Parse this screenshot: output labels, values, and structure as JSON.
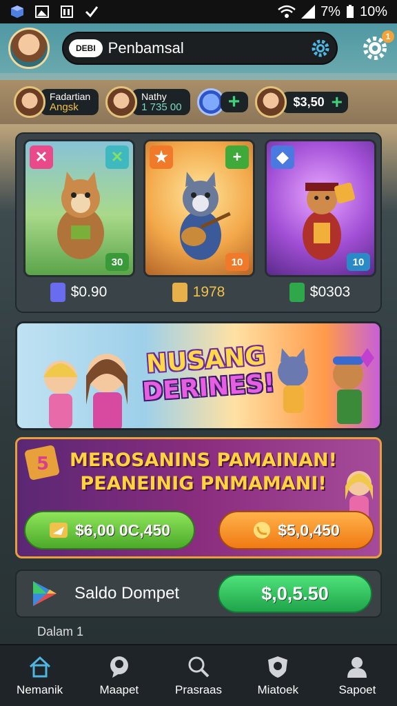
{
  "status_bar": {
    "signal_text": "7%",
    "battery_text": "10%"
  },
  "header": {
    "logo_text": "DEBI",
    "title": "Penbamsal",
    "notification_count": "1"
  },
  "friends": [
    {
      "name": "Fadartian",
      "value": "Angsk"
    },
    {
      "name": "Nathy",
      "value": "1 735 00"
    },
    {
      "name": "",
      "value": ""
    },
    {
      "name": "",
      "value": "$3,50"
    }
  ],
  "cards": [
    {
      "level": "30",
      "price": "$0.90",
      "tag_left": "✕",
      "tag_right": "✕",
      "price_color": "#6a6cf0"
    },
    {
      "level": "10",
      "price": "1978",
      "tag_left": "★",
      "tag_right": "+",
      "price_color": "#e8b04a"
    },
    {
      "level": "10",
      "price": "$0303",
      "tag_left": "◆",
      "tag_right": "",
      "price_color": "#2ea84a"
    }
  ],
  "banner": {
    "line1": "NUSANG",
    "line2": "DERINES!"
  },
  "promo": {
    "line1": "MEROSANINS PAMAINAN!",
    "line2": "PEANEINIG PNMAMANI!",
    "btn_green": "$6,00 0C,450",
    "btn_orange": "$5,0,450"
  },
  "wallet": {
    "label": "Saldo Dompet",
    "amount": "$,0,5.50"
  },
  "peek_text": "Dalam 1",
  "nav": [
    {
      "label": "Nemanik",
      "icon": "home-icon"
    },
    {
      "label": "Maapet",
      "icon": "chat-icon"
    },
    {
      "label": "Prasraas",
      "icon": "search-icon"
    },
    {
      "label": "Miatoek",
      "icon": "shield-icon"
    },
    {
      "label": "Sapoet",
      "icon": "user-icon"
    }
  ],
  "colors": {
    "accent_green": "#4caa2a",
    "accent_orange": "#f07a14",
    "promo_border": "#e8a03a"
  }
}
